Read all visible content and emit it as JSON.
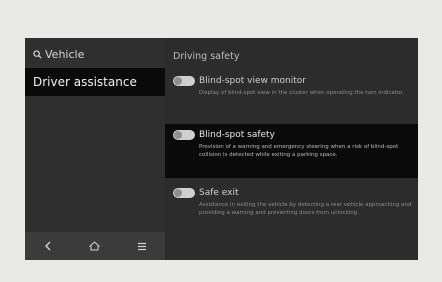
{
  "sidebar": {
    "header_label": "Vehicle",
    "selected_item": "Driver assistance"
  },
  "main": {
    "title": "Driving safety",
    "items": [
      {
        "title": "Blind-spot view monitor",
        "desc": "Display of blind-spot view in the cluster when operating the turn indicator."
      },
      {
        "title": "Blind-spot safety",
        "desc": "Provision of a warning and emergency steering when a risk of blind-spot collision is detected while exiting a parking space."
      },
      {
        "title": "Safe exit",
        "desc": "Assistance in exiting the vehicle by detecting a rear vehicle approaching and providing a warning and preventing doors from unlocking."
      }
    ]
  },
  "nav": {
    "back_icon": "back-icon",
    "home_icon": "home-icon",
    "menu_icon": "menu-icon"
  }
}
